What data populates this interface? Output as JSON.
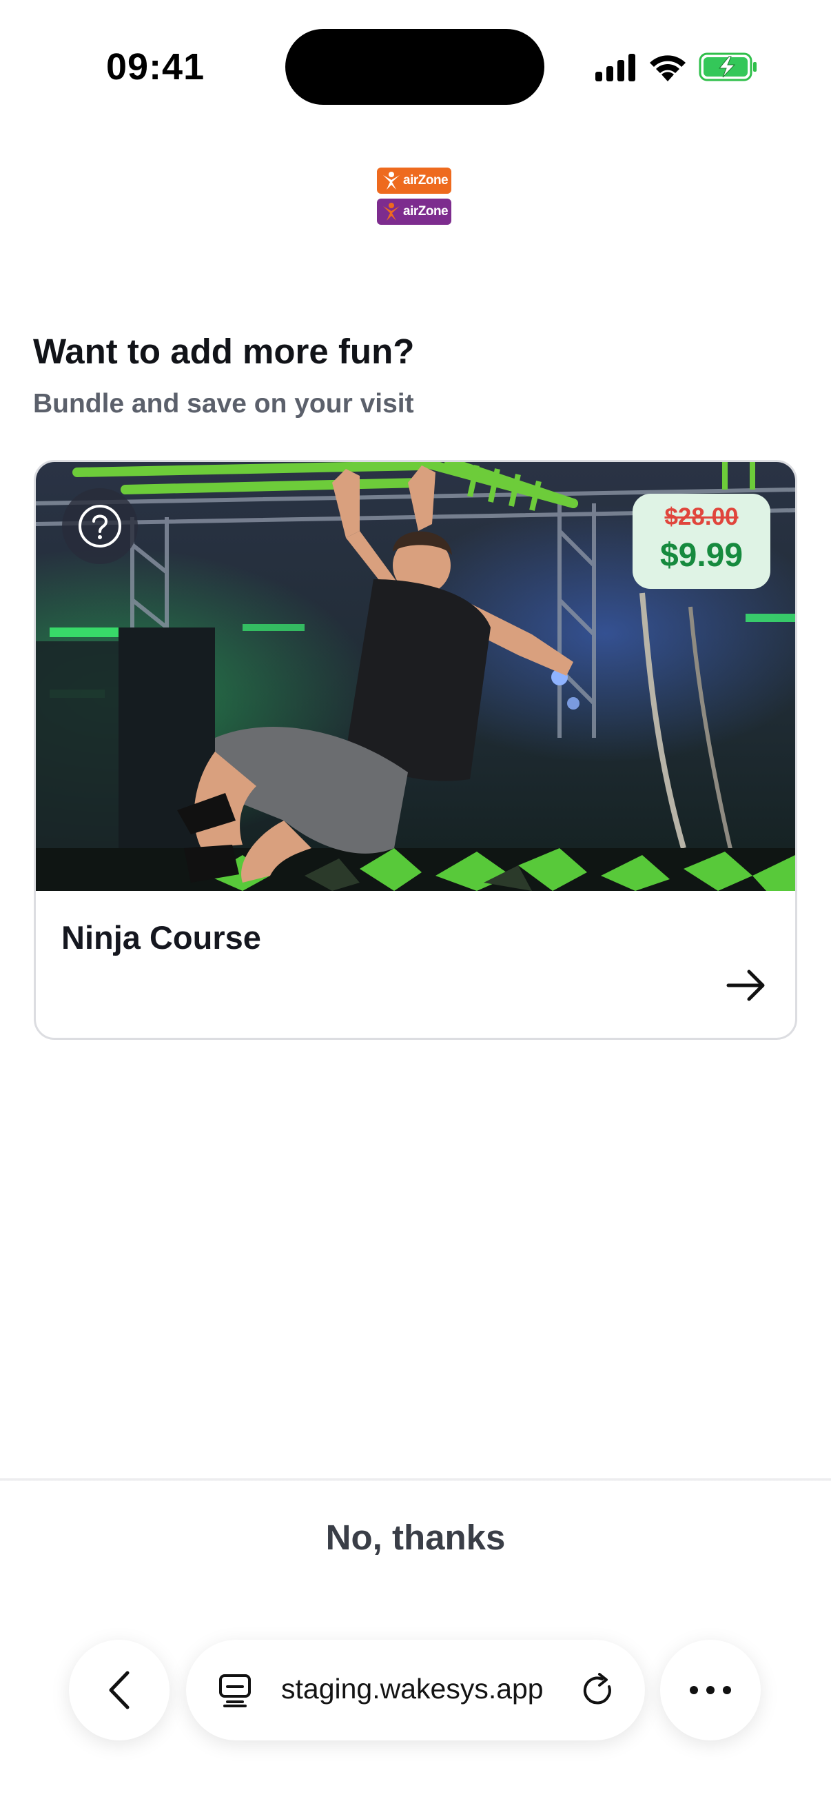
{
  "status_bar": {
    "time": "09:41",
    "icons": [
      "cellular-signal-icon",
      "wifi-icon",
      "battery-charging-icon"
    ]
  },
  "logo": {
    "brand_text": "airZone",
    "colors": [
      "#ee6a1e",
      "#7d2c8e"
    ]
  },
  "page": {
    "title": "Want to add more fun?",
    "subtitle": "Bundle and save on your visit"
  },
  "offer_card": {
    "title": "Ninja Course",
    "original_price": "$28.00",
    "sale_price": "$9.99",
    "help_icon": "question-circle-icon",
    "arrow_icon": "arrow-right-icon"
  },
  "actions": {
    "decline_label": "No, thanks"
  },
  "browser": {
    "url": "staging.wakesys.app",
    "back_icon": "chevron-left-icon",
    "tabs_icon": "tabs-icon",
    "reload_icon": "reload-icon",
    "more_icon": "more-dots-icon"
  },
  "colors": {
    "old_price": "#e0453c",
    "new_price": "#168a3e",
    "price_badge_bg": "#dff3e5",
    "neon_green": "#6dcc3a"
  }
}
